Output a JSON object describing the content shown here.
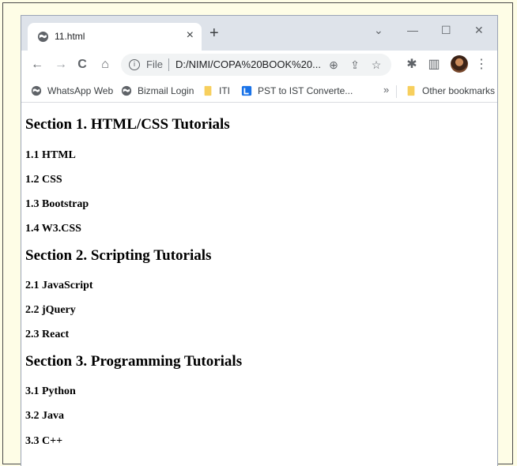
{
  "tab": {
    "title": "11.html",
    "close": "×",
    "new_tab": "+"
  },
  "window_controls": {
    "list": "⌄",
    "minimize": "—",
    "maximize": "☐",
    "close": "✕"
  },
  "toolbar": {
    "back": "←",
    "forward": "→",
    "reload": "C",
    "home": "⌂",
    "protocol_label": "File",
    "url": "D:/NIMI/COPA%20BOOK%20...",
    "zoom": "⊕",
    "share": "⇪",
    "bookmark": "☆",
    "extensions": "✱",
    "side_panel": "▥",
    "menu": "⋮"
  },
  "bookmarks": {
    "items": [
      {
        "label": "WhatsApp Web",
        "icon": "globe-icon"
      },
      {
        "label": "Bizmail Login",
        "icon": "globe-icon"
      },
      {
        "label": "ITI",
        "icon": "folder-icon"
      },
      {
        "label": "PST to IST Converte...",
        "icon": "blue-square-icon"
      }
    ],
    "overflow": "»",
    "other": "Other bookmarks"
  },
  "page": {
    "sections": [
      {
        "heading": "Section 1. HTML/CSS Tutorials",
        "items": [
          "1.1 HTML",
          "1.2 CSS",
          "1.3 Bootstrap",
          "1.4 W3.CSS"
        ]
      },
      {
        "heading": "Section 2. Scripting Tutorials",
        "items": [
          "2.1 JavaScript",
          "2.2 jQuery",
          "2.3 React"
        ]
      },
      {
        "heading": "Section 3. Programming Tutorials",
        "items": [
          "3.1 Python",
          "3.2 Java",
          "3.3 C++"
        ]
      }
    ]
  },
  "colors": {
    "page_background": "#fefde6",
    "tabstrip": "#dee3ea",
    "omnibox": "#f1f3f4",
    "folder": "#f7cf5d",
    "blue_badge": "#1a73e8"
  }
}
